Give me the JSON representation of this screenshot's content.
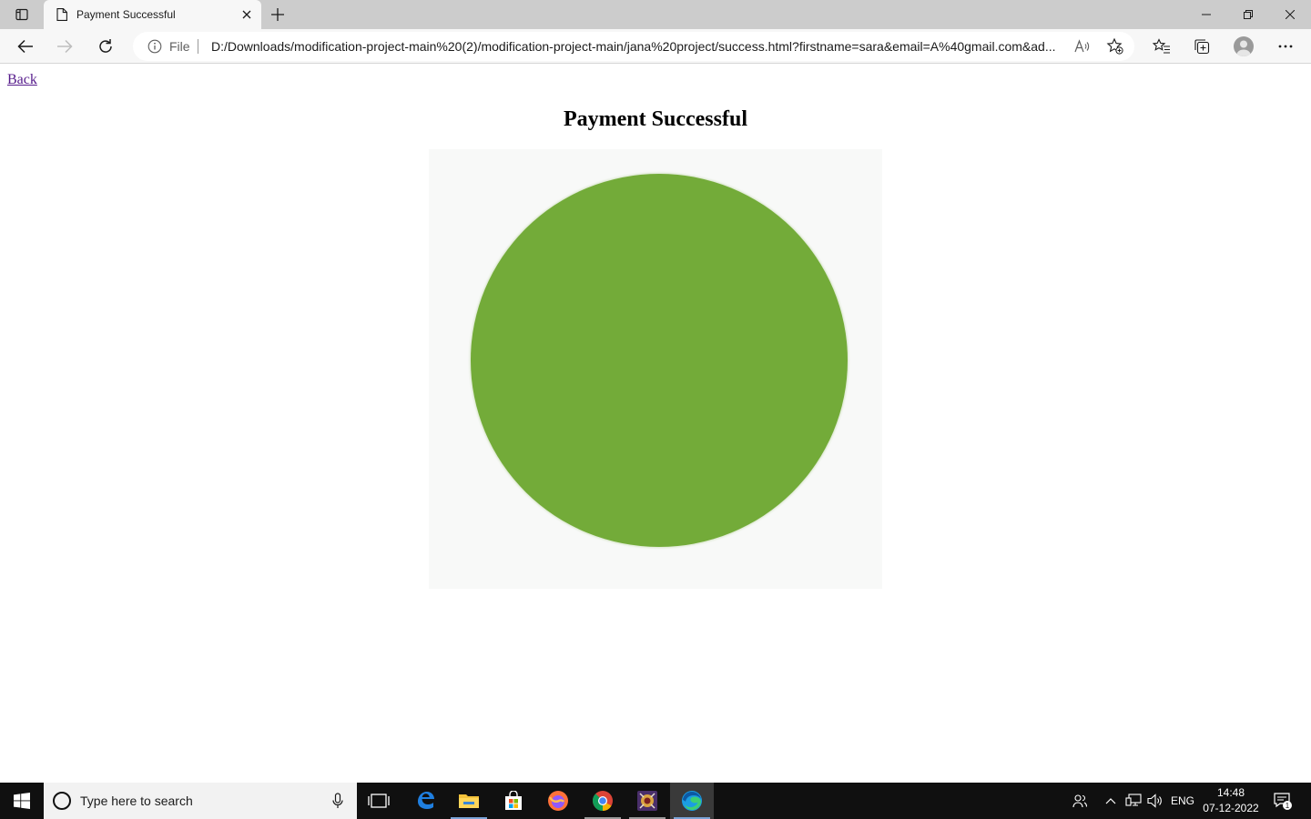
{
  "browser": {
    "tab_title": "Payment Successful",
    "address_scheme_label": "File",
    "url": "D:/Downloads/modification-project-main%20(2)/modification-project-main/jana%20project/success.html?firstname=sara&email=A%40gmail.com&ad..."
  },
  "page": {
    "back_link": "Back",
    "title": "Payment Successful",
    "image_fill_color": "#73ab39"
  },
  "taskbar": {
    "search_placeholder": "Type here to search",
    "language": "ENG",
    "time": "14:48",
    "date": "07-12-2022",
    "notification_count": "1"
  },
  "icons": [
    "tab-actions-icon",
    "page-favicon-icon",
    "close-tab-icon",
    "new-tab-icon",
    "minimize-icon",
    "restore-icon",
    "close-window-icon",
    "back-arrow-icon",
    "forward-arrow-icon",
    "refresh-icon",
    "info-icon",
    "read-aloud-icon",
    "add-favorite-icon",
    "favorites-icon",
    "collections-icon",
    "profile-avatar",
    "more-menu-icon",
    "windows-start-icon",
    "microphone-icon",
    "task-view-icon",
    "edge-legacy-icon",
    "file-explorer-icon",
    "store-icon",
    "firefox-icon",
    "chrome-icon",
    "game-app-icon",
    "edge-icon",
    "people-icon",
    "chevron-up-icon",
    "network-icon",
    "volume-icon",
    "notification-icon"
  ]
}
